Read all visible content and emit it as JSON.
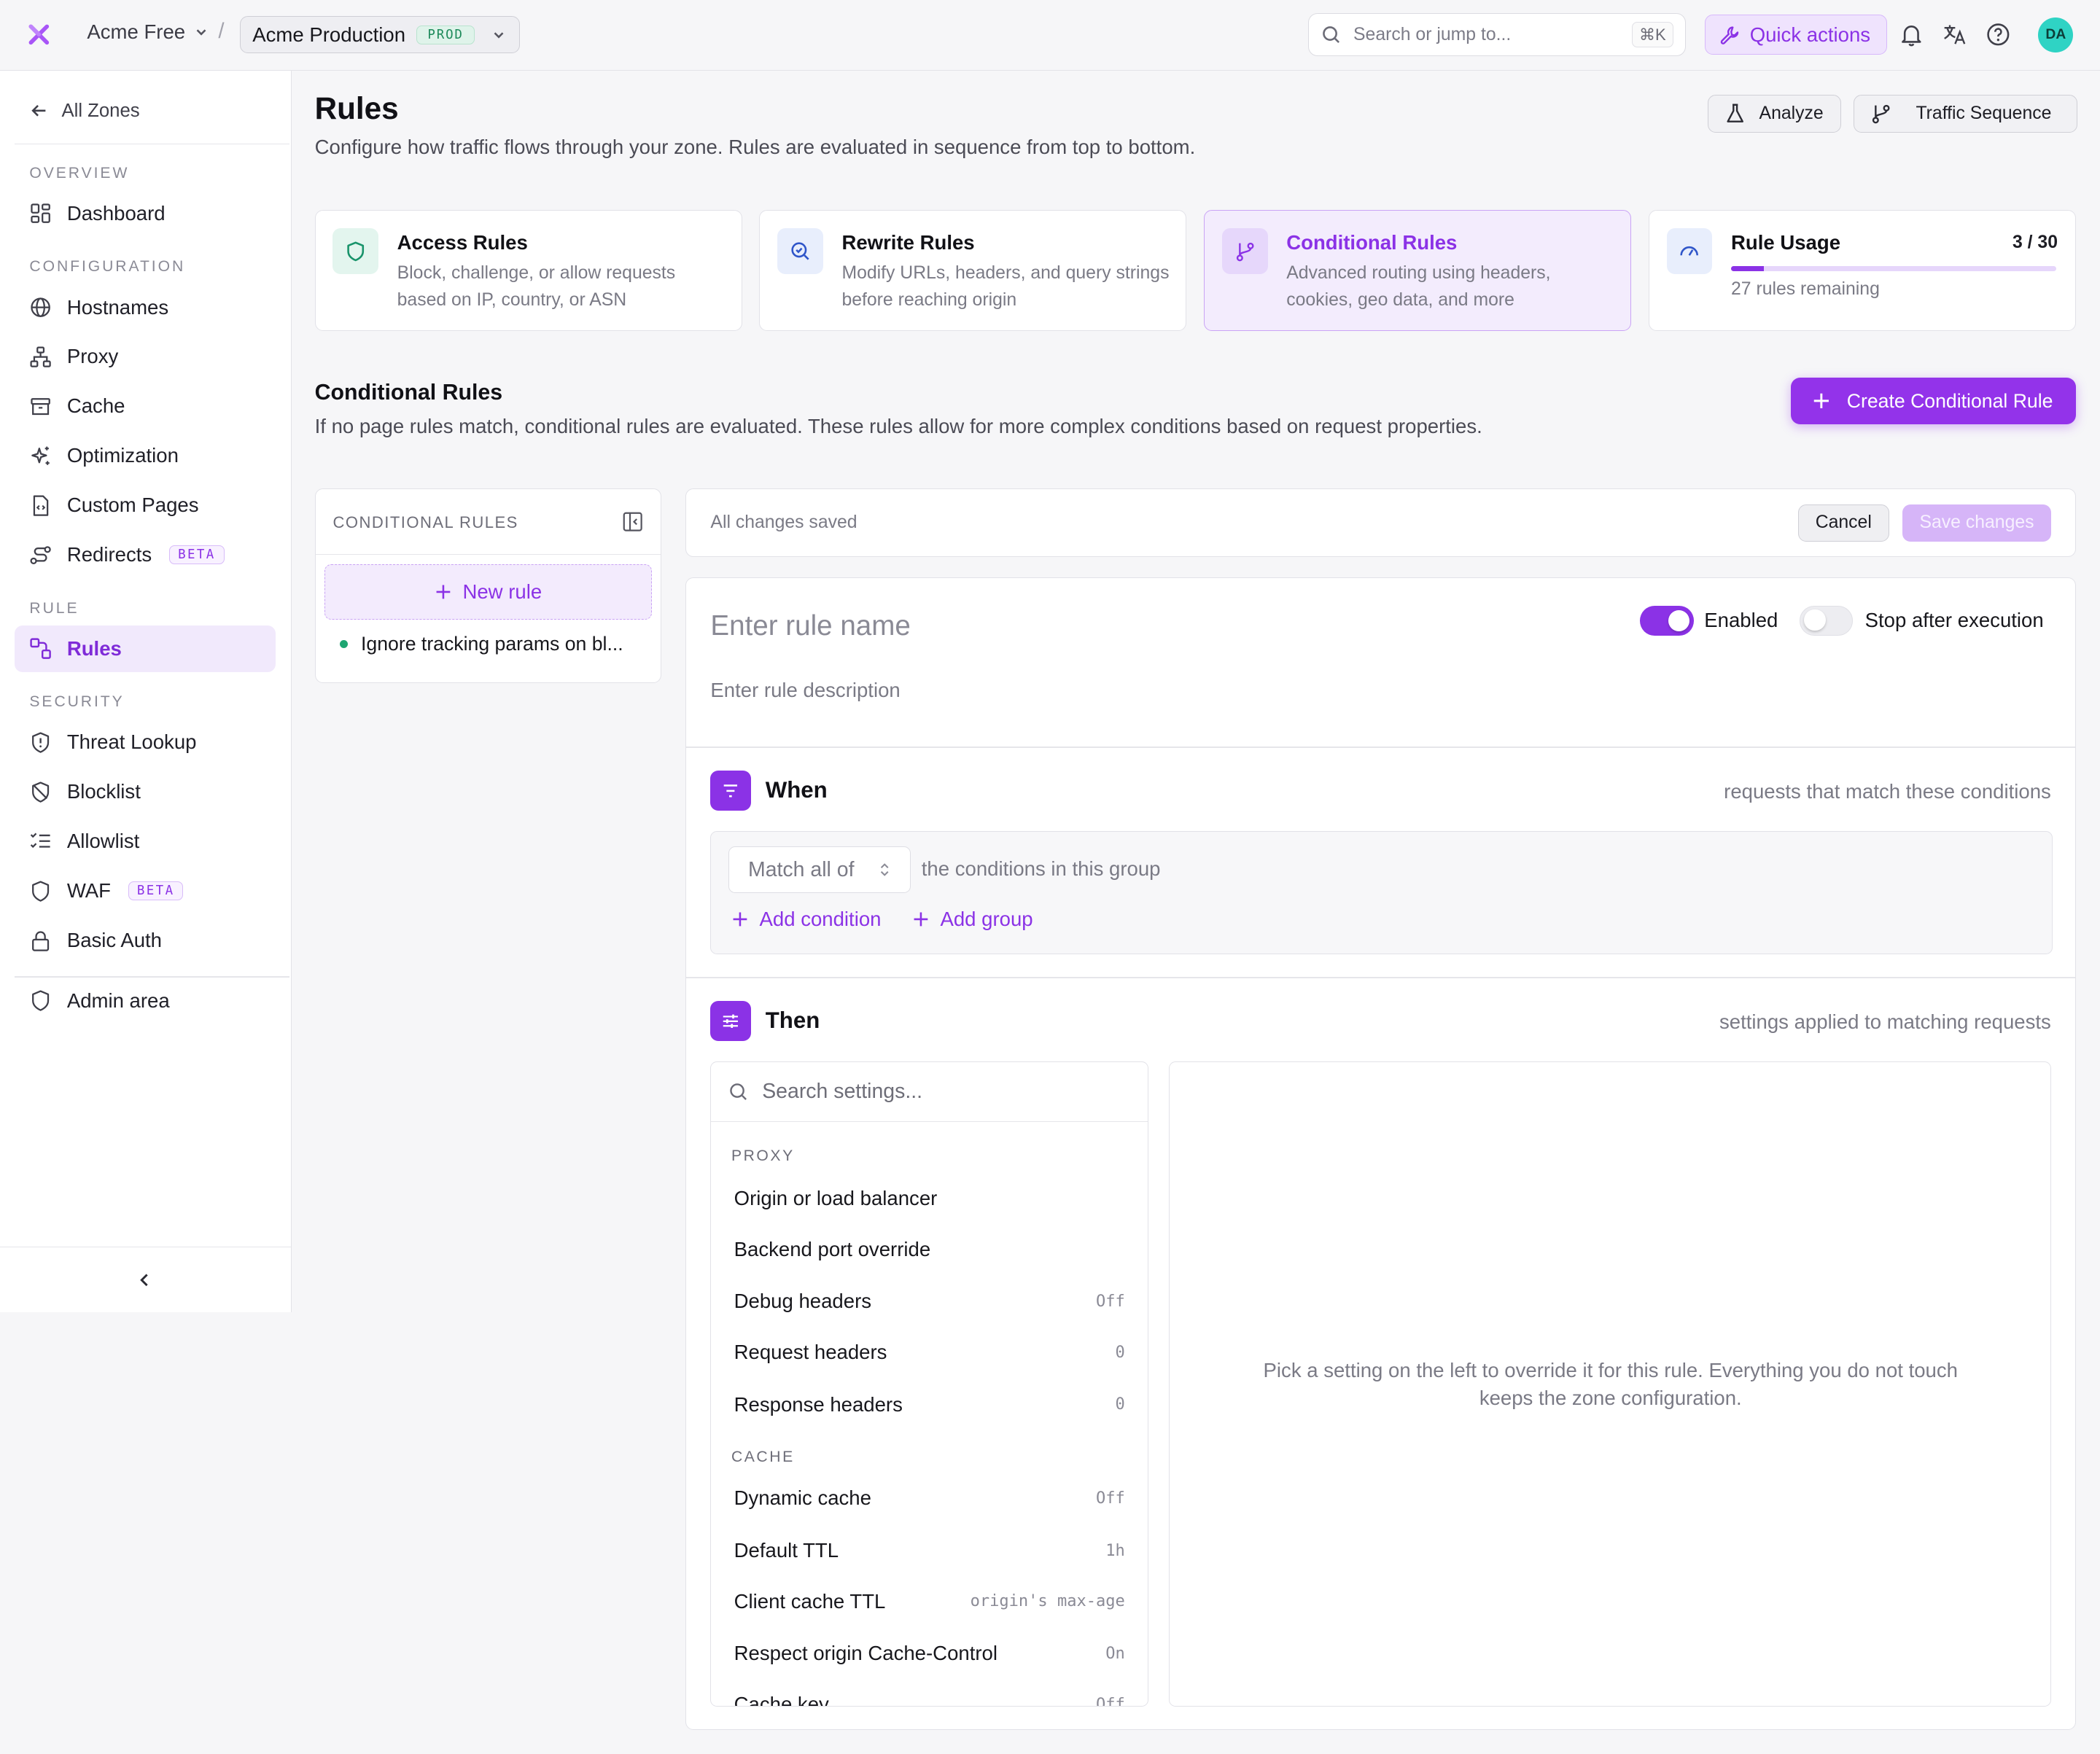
{
  "topbar": {
    "org_name": "Acme Free",
    "separator": "/",
    "zone_name": "Acme Production",
    "zone_env_badge": "PROD",
    "search_placeholder": "Search or jump to...",
    "search_shortcut": "⌘K",
    "quick_actions_label": "Quick actions",
    "avatar_initials": "DA",
    "icons": [
      "logo-x-icon",
      "bell-icon",
      "translate-icon",
      "help-icon"
    ]
  },
  "sidebar": {
    "back_label": "All Zones",
    "sections": [
      {
        "label": "OVERVIEW",
        "items": [
          {
            "label": "Dashboard",
            "icon": "grid-icon"
          }
        ]
      },
      {
        "label": "CONFIGURATION",
        "items": [
          {
            "label": "Hostnames",
            "icon": "globe-icon"
          },
          {
            "label": "Proxy",
            "icon": "network-icon"
          },
          {
            "label": "Cache",
            "icon": "archive-icon"
          },
          {
            "label": "Optimization",
            "icon": "sparkles-icon"
          },
          {
            "label": "Custom Pages",
            "icon": "file-code-icon"
          },
          {
            "label": "Redirects",
            "icon": "route-icon",
            "badge": "BETA"
          }
        ]
      },
      {
        "label": "RULE",
        "items": [
          {
            "label": "Rules",
            "icon": "rules-icon",
            "active": true
          }
        ]
      },
      {
        "label": "SECURITY",
        "items": [
          {
            "label": "Threat Lookup",
            "icon": "shield-alert-icon"
          },
          {
            "label": "Blocklist",
            "icon": "shield-off-icon"
          },
          {
            "label": "Allowlist",
            "icon": "list-checks-icon"
          },
          {
            "label": "WAF",
            "icon": "shield-icon",
            "badge": "BETA"
          },
          {
            "label": "Basic Auth",
            "icon": "lock-icon"
          }
        ]
      }
    ],
    "admin_label": "Admin area"
  },
  "header": {
    "title": "Rules",
    "subtitle": "Configure how traffic flows through your zone. Rules are evaluated in sequence from top to bottom.",
    "analyze_label": "Analyze",
    "traffic_label": "Traffic Sequence"
  },
  "cards": [
    {
      "title": "Access Rules",
      "desc": "Block, challenge, or allow requests based on IP, country, or ASN"
    },
    {
      "title": "Rewrite Rules",
      "desc": "Modify URLs, headers, and query strings before reaching origin"
    },
    {
      "title": "Conditional Rules",
      "desc": "Advanced routing using headers, cookies, geo data, and more"
    }
  ],
  "usage": {
    "title": "Rule Usage",
    "value": "3 / 30",
    "used_fraction": 0.1,
    "remaining": "27 rules remaining"
  },
  "conditional": {
    "title": "Conditional Rules",
    "subtitle": "If no page rules match, conditional rules are evaluated. These rules allow for more complex conditions based on request properties.",
    "create_label": "Create Conditional Rule",
    "list_label": "CONDITIONAL RULES",
    "new_rule_label": "New rule",
    "rules": [
      "Ignore tracking params on bl..."
    ]
  },
  "savebar": {
    "status": "All changes saved",
    "cancel": "Cancel",
    "save": "Save changes"
  },
  "editor": {
    "name_placeholder": "Enter rule name",
    "desc_placeholder": "Enter rule description",
    "enabled_label": "Enabled",
    "stop_label": "Stop after execution",
    "when_title": "When",
    "when_hint": "requests that match these conditions",
    "match_value": "Match all of",
    "cond_text": "the conditions in this group",
    "add_condition": "Add condition",
    "add_group": "Add group",
    "then_title": "Then",
    "then_hint": "settings applied to matching requests",
    "settings_placeholder": "Search settings...",
    "groups": [
      {
        "label": "PROXY",
        "items": [
          {
            "label": "Origin or load balancer",
            "value": ""
          },
          {
            "label": "Backend port override",
            "value": ""
          },
          {
            "label": "Debug headers",
            "value": "Off"
          },
          {
            "label": "Request headers",
            "value": "0"
          },
          {
            "label": "Response headers",
            "value": "0"
          }
        ]
      },
      {
        "label": "CACHE",
        "items": [
          {
            "label": "Dynamic cache",
            "value": "Off"
          },
          {
            "label": "Default TTL",
            "value": "1h"
          },
          {
            "label": "Client cache TTL",
            "value": "origin's max-age"
          },
          {
            "label": "Respect origin Cache-Control",
            "value": "On"
          },
          {
            "label": "Cache key",
            "value": "Off"
          }
        ]
      }
    ],
    "detail_hint": "Pick a setting on the left to override it for this rule. Everything you do not touch keeps the zone configuration."
  },
  "colors": {
    "accent": "#8b32e6",
    "accent_bg": "#f3ecfd",
    "success": "#1ea672"
  }
}
